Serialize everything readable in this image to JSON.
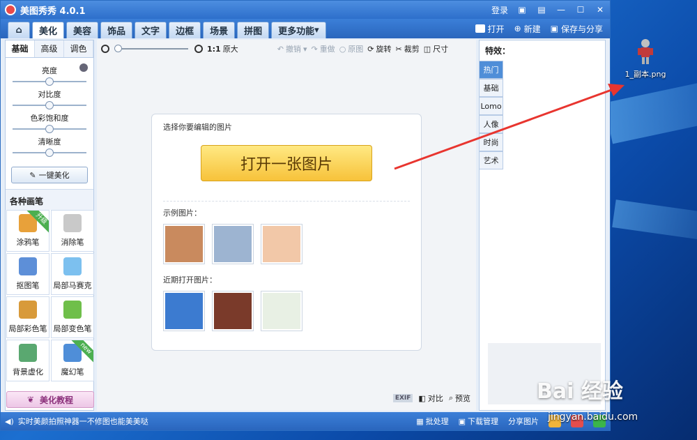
{
  "window": {
    "app_title": "美图秀秀 4.0.1",
    "login": "登录"
  },
  "menu": {
    "tabs": [
      "美化",
      "美容",
      "饰品",
      "文字",
      "边框",
      "场景",
      "拼图",
      "更多功能"
    ],
    "right": {
      "open": "打开",
      "new": "新建",
      "save_share": "保存与分享"
    }
  },
  "left": {
    "subtabs": [
      "基础",
      "高级",
      "调色"
    ],
    "sliders": [
      {
        "label": "亮度",
        "level": 0.5
      },
      {
        "label": "对比度",
        "level": 0.5
      },
      {
        "label": "色彩饱和度",
        "level": 0.5
      },
      {
        "label": "清晰度",
        "level": 0.5
      }
    ],
    "onekey": "一键美化",
    "brush_title": "各种画笔",
    "brushes": [
      {
        "label": "涂鸦笔",
        "badge": "升级",
        "color": "#e8a13a"
      },
      {
        "label": "消除笔",
        "badge": "",
        "color": "#c9c9c9"
      },
      {
        "label": "抠图笔",
        "badge": "",
        "color": "#5d8fd8"
      },
      {
        "label": "局部马赛克",
        "badge": "",
        "color": "#7cc0ef"
      },
      {
        "label": "局部彩色笔",
        "badge": "",
        "color": "#d89a3a"
      },
      {
        "label": "局部变色笔",
        "badge": "",
        "color": "#6fbf4a"
      },
      {
        "label": "背景虚化",
        "badge": "",
        "color": "#5aa870"
      },
      {
        "label": "魔幻笔",
        "badge": "new",
        "color": "#4f8ed8"
      }
    ],
    "tutorial": "美化教程"
  },
  "toolbar": {
    "ratio": "1:1",
    "original_size": "原大",
    "undo": "撤销",
    "redo": "重做",
    "original": "原图",
    "rotate": "旋转",
    "crop": "裁剪",
    "size": "尺寸"
  },
  "open_card": {
    "prompt": "选择你要编辑的图片",
    "button": "打开一张图片",
    "examples_label": "示例图片：",
    "recent_label": "近期打开图片：",
    "example_colors": [
      "#c98a5e",
      "#9db4d1",
      "#f2c8a8"
    ],
    "recent_colors": [
      "#3c7bd0",
      "#7a3a2a",
      "#e8f0e4"
    ]
  },
  "canvas_bottom": {
    "exif": "EXIF",
    "compare": "对比",
    "preview": "预览"
  },
  "right": {
    "title": "特效：",
    "effects": [
      "热门",
      "基础",
      "Lomo",
      "人像",
      "时尚",
      "艺术"
    ]
  },
  "status": {
    "message": "实时美颜拍照神器一不修图也能美美哒",
    "batch": "批处理",
    "download": "下载管理",
    "share": "分享图片"
  },
  "desktop": {
    "icon_label": "1_副本.png"
  },
  "watermark": {
    "brand": "Bai 经验",
    "url": "jingyan.baidu.com"
  }
}
